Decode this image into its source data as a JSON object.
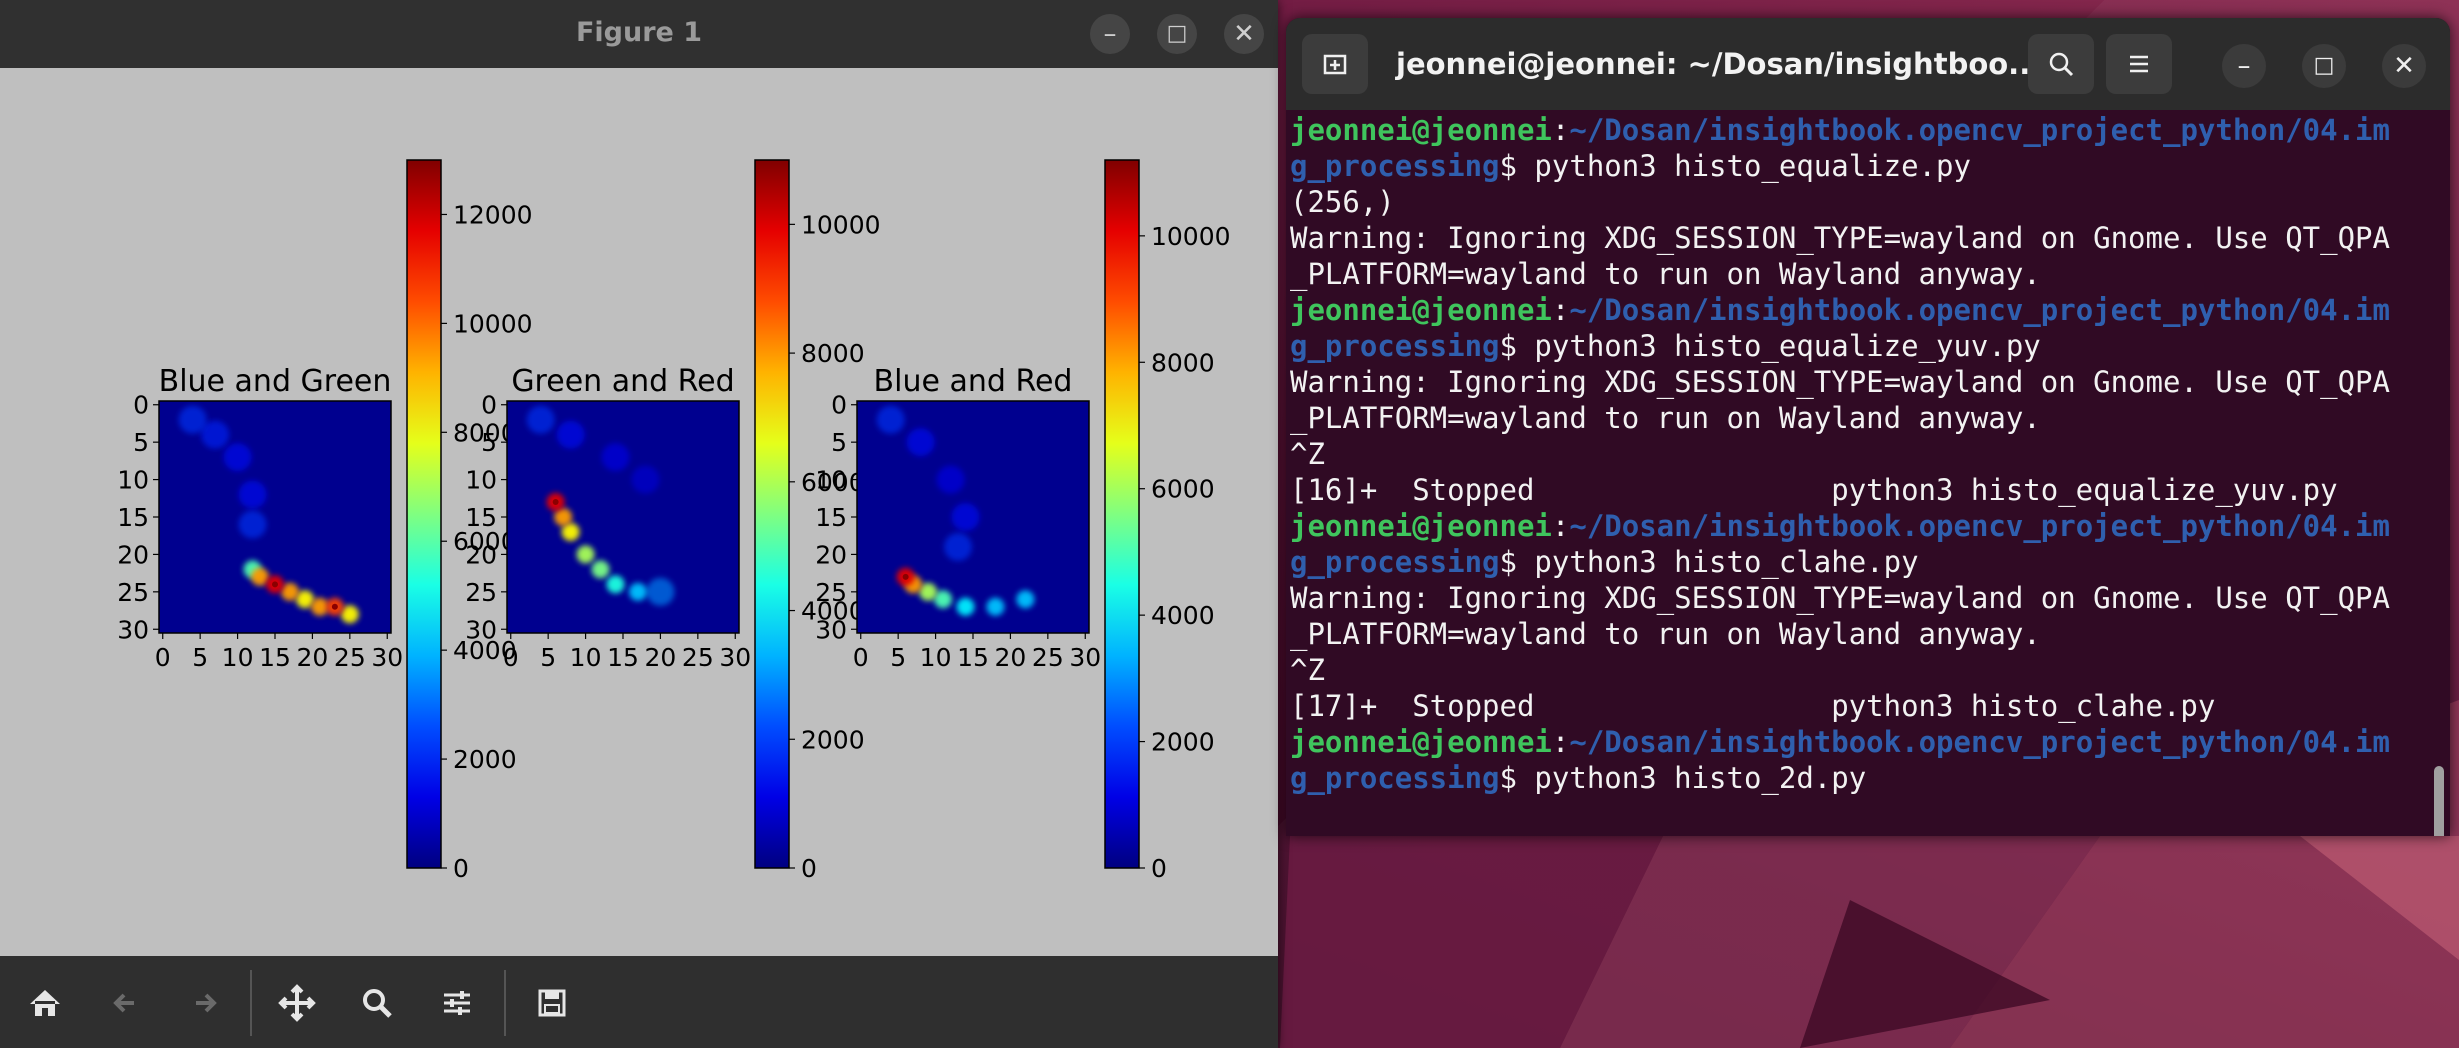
{
  "figure_window": {
    "title": "Figure 1",
    "controls": {
      "minimize": "–",
      "maximize": "□",
      "close": "✕"
    },
    "toolbar": {
      "home_icon": "home-icon",
      "back_icon": "back-arrow-icon",
      "forward_icon": "forward-arrow-icon",
      "pan_icon": "pan-move-icon",
      "zoom_icon": "zoom-magnifier-icon",
      "configure_icon": "configure-sliders-icon",
      "save_icon": "save-disk-icon"
    }
  },
  "chart_data": [
    {
      "type": "heatmap",
      "title": "Blue and Green",
      "x_ticks": [
        "0",
        "5",
        "10",
        "15",
        "20",
        "25",
        "30"
      ],
      "y_ticks": [
        "0",
        "5",
        "10",
        "15",
        "20",
        "25",
        "30"
      ],
      "xlim": [
        0,
        31
      ],
      "ylim": [
        31,
        0
      ],
      "colorbar": {
        "ticks": [
          "0",
          "2000",
          "4000",
          "6000",
          "8000",
          "10000",
          "12000"
        ],
        "max": 13000
      },
      "colormap": "jet",
      "hot_points": [
        [
          13,
          23,
          0.8
        ],
        [
          15,
          24,
          1.0
        ],
        [
          17,
          25,
          0.8
        ],
        [
          19,
          26,
          0.7
        ],
        [
          21,
          27,
          0.8
        ],
        [
          23,
          27,
          0.9
        ],
        [
          25,
          28,
          0.7
        ],
        [
          12,
          22,
          0.5
        ],
        [
          4,
          2,
          0.2
        ],
        [
          7,
          4,
          0.18
        ],
        [
          10,
          7,
          0.15
        ],
        [
          12,
          12,
          0.15
        ],
        [
          12,
          16,
          0.2
        ]
      ]
    },
    {
      "type": "heatmap",
      "title": "Green and Red",
      "x_ticks": [
        "0",
        "5",
        "10",
        "15",
        "20",
        "25",
        "30"
      ],
      "y_ticks": [
        "0",
        "5",
        "10",
        "15",
        "20",
        "25",
        "30"
      ],
      "xlim": [
        0,
        31
      ],
      "ylim": [
        31,
        0
      ],
      "colorbar": {
        "ticks": [
          "0",
          "2000",
          "4000",
          "6000",
          "8000",
          "10000"
        ],
        "max": 11000
      },
      "colormap": "jet",
      "hot_points": [
        [
          6,
          13,
          1.0
        ],
        [
          7,
          15,
          0.8
        ],
        [
          8,
          17,
          0.7
        ],
        [
          10,
          20,
          0.6
        ],
        [
          12,
          22,
          0.55
        ],
        [
          14,
          24,
          0.45
        ],
        [
          17,
          25,
          0.35
        ],
        [
          20,
          25,
          0.3
        ],
        [
          4,
          2,
          0.2
        ],
        [
          8,
          4,
          0.15
        ],
        [
          14,
          7,
          0.12
        ],
        [
          18,
          10,
          0.1
        ]
      ]
    },
    {
      "type": "heatmap",
      "title": "Blue and Red",
      "x_ticks": [
        "0",
        "5",
        "10",
        "15",
        "20",
        "25",
        "30"
      ],
      "y_ticks": [
        "0",
        "5",
        "10",
        "15",
        "20",
        "25",
        "30"
      ],
      "xlim": [
        0,
        31
      ],
      "ylim": [
        31,
        0
      ],
      "colorbar": {
        "ticks": [
          "0",
          "2000",
          "4000",
          "6000",
          "8000",
          "10000"
        ],
        "max": 11200
      },
      "colormap": "jet",
      "hot_points": [
        [
          6,
          23,
          1.0
        ],
        [
          7,
          24,
          0.8
        ],
        [
          9,
          25,
          0.6
        ],
        [
          11,
          26,
          0.5
        ],
        [
          14,
          27,
          0.4
        ],
        [
          18,
          27,
          0.35
        ],
        [
          22,
          26,
          0.35
        ],
        [
          4,
          2,
          0.2
        ],
        [
          8,
          5,
          0.15
        ],
        [
          12,
          10,
          0.12
        ],
        [
          14,
          15,
          0.15
        ],
        [
          13,
          19,
          0.2
        ]
      ]
    }
  ],
  "terminal": {
    "title": "jeonnei@jeonnei: ~/Dosan/insightboo...",
    "buttons": {
      "new_tab_icon": "new-tab-icon",
      "search_icon": "search-icon",
      "menu_icon": "hamburger-menu-icon",
      "minimize": "–",
      "maximize": "□",
      "close": "✕"
    },
    "lines": [
      {
        "user": "jeonnei@jeonnei",
        "colon": ":",
        "path": "~/Dosan/insightbook.opencv_project_python/04.im",
        "text": ""
      },
      {
        "user": "",
        "colon": "",
        "path": "g_processing",
        "text": "$ python3 histo_equalize.py"
      },
      {
        "user": "",
        "colon": "",
        "path": "",
        "text": "(256,)"
      },
      {
        "user": "",
        "colon": "",
        "path": "",
        "text": "Warning: Ignoring XDG_SESSION_TYPE=wayland on Gnome. Use QT_QPA"
      },
      {
        "user": "",
        "colon": "",
        "path": "",
        "text": "_PLATFORM=wayland to run on Wayland anyway."
      },
      {
        "user": "jeonnei@jeonnei",
        "colon": ":",
        "path": "~/Dosan/insightbook.opencv_project_python/04.im",
        "text": ""
      },
      {
        "user": "",
        "colon": "",
        "path": "g_processing",
        "text": "$ python3 histo_equalize_yuv.py"
      },
      {
        "user": "",
        "colon": "",
        "path": "",
        "text": "Warning: Ignoring XDG_SESSION_TYPE=wayland on Gnome. Use QT_QPA"
      },
      {
        "user": "",
        "colon": "",
        "path": "",
        "text": "_PLATFORM=wayland to run on Wayland anyway."
      },
      {
        "user": "",
        "colon": "",
        "path": "",
        "text": "^Z"
      },
      {
        "user": "",
        "colon": "",
        "path": "",
        "text": "[16]+  Stopped                 python3 histo_equalize_yuv.py"
      },
      {
        "user": "jeonnei@jeonnei",
        "colon": ":",
        "path": "~/Dosan/insightbook.opencv_project_python/04.im",
        "text": ""
      },
      {
        "user": "",
        "colon": "",
        "path": "g_processing",
        "text": "$ python3 histo_clahe.py"
      },
      {
        "user": "",
        "colon": "",
        "path": "",
        "text": "Warning: Ignoring XDG_SESSION_TYPE=wayland on Gnome. Use QT_QPA"
      },
      {
        "user": "",
        "colon": "",
        "path": "",
        "text": "_PLATFORM=wayland to run on Wayland anyway."
      },
      {
        "user": "",
        "colon": "",
        "path": "",
        "text": "^Z"
      },
      {
        "user": "",
        "colon": "",
        "path": "",
        "text": "[17]+  Stopped                 python3 histo_clahe.py"
      },
      {
        "user": "jeonnei@jeonnei",
        "colon": ":",
        "path": "~/Dosan/insightbook.opencv_project_python/04.im",
        "text": ""
      },
      {
        "user": "",
        "colon": "",
        "path": "g_processing",
        "text": "$ python3 histo_2d.py"
      }
    ]
  }
}
